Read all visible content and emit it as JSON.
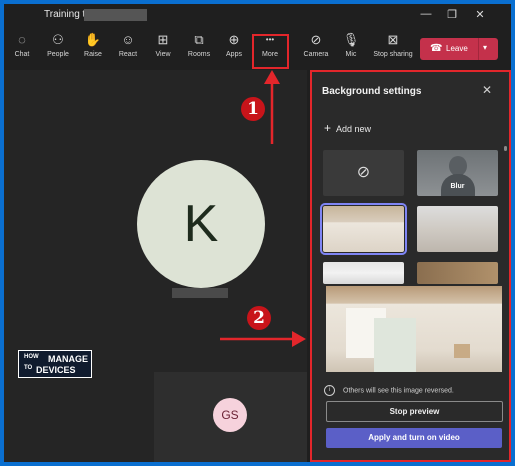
{
  "window": {
    "title": "Training to",
    "controls": {
      "minimize": "—",
      "maximize": "❐",
      "close": "✕"
    }
  },
  "toolbar": {
    "items": [
      {
        "label": "Chat",
        "icon": "chat-icon",
        "glyph": "◌"
      },
      {
        "label": "People",
        "icon": "people-icon",
        "glyph": "⚇"
      },
      {
        "label": "Raise",
        "icon": "hand-icon",
        "glyph": "✋"
      },
      {
        "label": "React",
        "icon": "smile-icon",
        "glyph": "☺"
      },
      {
        "label": "View",
        "icon": "grid-icon",
        "glyph": "⊞"
      },
      {
        "label": "Rooms",
        "icon": "rooms-icon",
        "glyph": "⧉"
      },
      {
        "label": "Apps",
        "icon": "plus-square-icon",
        "glyph": "⊕"
      },
      {
        "label": "More",
        "icon": "ellipsis-icon",
        "glyph": "•••"
      },
      {
        "label": "Camera",
        "icon": "camera-off-icon",
        "glyph": "⊘"
      },
      {
        "label": "Mic",
        "icon": "mic-icon",
        "glyph": "🎙"
      },
      {
        "label": "Stop sharing",
        "icon": "stop-share-icon",
        "glyph": "⊠"
      }
    ],
    "leave_label": "Leave"
  },
  "stage": {
    "main_initial": "K",
    "tile_initials": "GS"
  },
  "logo": {
    "line1a": "HOW",
    "line1b": "MANAGE",
    "line2a": "TO",
    "line2b": "DEVICES"
  },
  "panel": {
    "title": "Background settings",
    "add_new": "Add new",
    "blur_label": "Blur",
    "info_text": "Others will see this image reversed.",
    "stop_preview": "Stop preview",
    "apply": "Apply and turn on video"
  },
  "annotations": {
    "marker1": "1",
    "marker2": "2"
  },
  "colors": {
    "accent": "#5b5fc7",
    "leave": "#c4314b",
    "annotation_red": "#e3262b",
    "border_blue": "#0a6fd0"
  }
}
